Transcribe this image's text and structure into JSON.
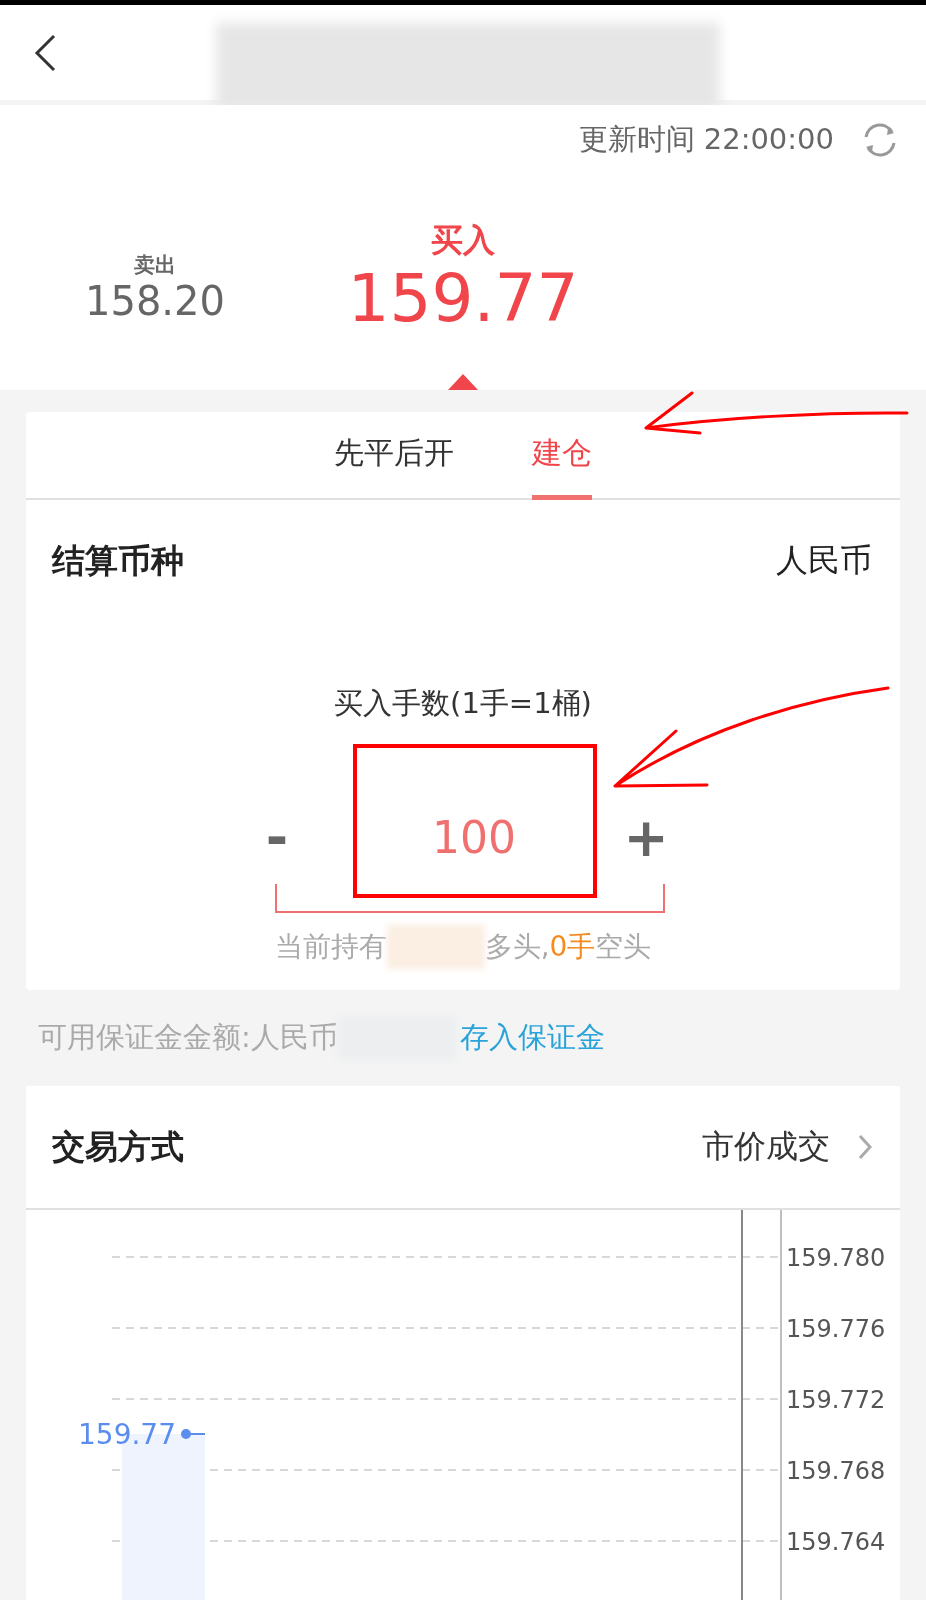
{
  "header": {
    "update_label": "更新时间 22:00:00"
  },
  "quotes": [
    {
      "kind": "sell",
      "label": "卖出",
      "price": "158.20",
      "selected": false
    },
    {
      "kind": "buy",
      "label": "买入",
      "price": "159.77",
      "selected": true
    }
  ],
  "tabs": [
    {
      "label": "先平后开",
      "selected": false
    },
    {
      "label": "建仓",
      "selected": true
    }
  ],
  "currency": {
    "label": "结算币种",
    "value": "人民币"
  },
  "lots": {
    "label": "买入手数(1手=1桶)",
    "minus": "-",
    "value": "100",
    "plus": "+"
  },
  "holding": {
    "prefix": "当前持有",
    "long": "多头,",
    "short_count": "0手",
    "suffix": "空头"
  },
  "margin": {
    "label": "可用保证金金额:人民币",
    "link": "存入保证金"
  },
  "trade_mode": {
    "label": "交易方式",
    "value": "市价成交"
  },
  "price_chart": {
    "axis_labels": [
      "159.780",
      "159.776",
      "159.772",
      "159.768",
      "159.764"
    ],
    "current_price": "159.77"
  }
}
